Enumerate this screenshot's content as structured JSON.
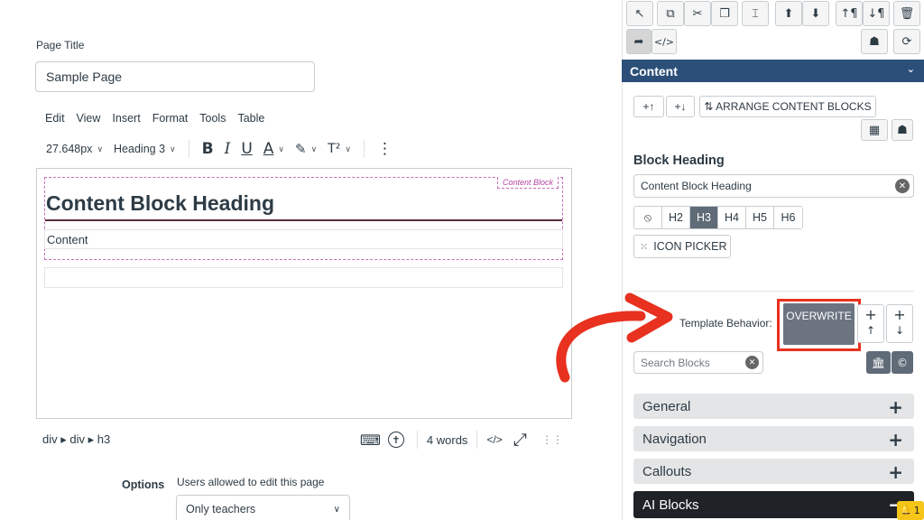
{
  "editor": {
    "page_title_label": "Page Title",
    "page_title_value": "Sample Page",
    "menu": [
      "Edit",
      "View",
      "Insert",
      "Format",
      "Tools",
      "Table"
    ],
    "toolbar": {
      "font_size": "27.648px",
      "block_format": "Heading 3",
      "bold_icon": "B",
      "italic_icon": "I",
      "underline_icon": "U",
      "text_color_icon": "A",
      "highlight_icon": "✎",
      "superscript_icon": "T²",
      "more_icon": "⋮"
    },
    "content_block_tag": "Content Block",
    "content_block_heading": "Content Block Heading",
    "content_text": "Content",
    "status_path": "div ▸ div ▸ h3",
    "word_count": "4 words",
    "code_view": "</>",
    "fullscreen_icon": "⤢",
    "resize_icon": "⋮⋮",
    "options_label": "Options",
    "users_allowed_label": "Users allowed to edit this page",
    "users_allowed_value": "Only teachers"
  },
  "panel": {
    "top_tools": [
      "↖",
      "⧉",
      "✂",
      "❐",
      "⌶",
      "⬆",
      "⬇",
      "↑¶",
      "↓¶",
      "🗑"
    ],
    "second_row": [
      "➦",
      "</>"
    ],
    "content_title": "Content",
    "arrange": {
      "up_label": "+↑",
      "down_label": "+↓",
      "arrange_label": "⇅ ARRANGE CONTENT BLOCKS"
    },
    "block_heading_label": "Block Heading",
    "block_heading_value": "Content Block Heading",
    "heading_levels": [
      "⦸",
      "H2",
      "H3",
      "H4",
      "H5",
      "H6"
    ],
    "active_heading": "H3",
    "icon_picker_label": "ICON PICKER",
    "template_behavior_label": "Template Behavior:",
    "overwrite_label": "OVERWRITE",
    "search_placeholder": "Search Blocks",
    "accordions": [
      {
        "label": "General",
        "icon": "+"
      },
      {
        "label": "Navigation",
        "icon": "+"
      },
      {
        "label": "Callouts",
        "icon": "+"
      },
      {
        "label": "AI Blocks",
        "icon": "−"
      }
    ],
    "notification_count": "1"
  },
  "colors": {
    "content_bar": "#2b4f78",
    "highlight_red": "#e8311f",
    "overwrite_bg": "#6b7480"
  }
}
